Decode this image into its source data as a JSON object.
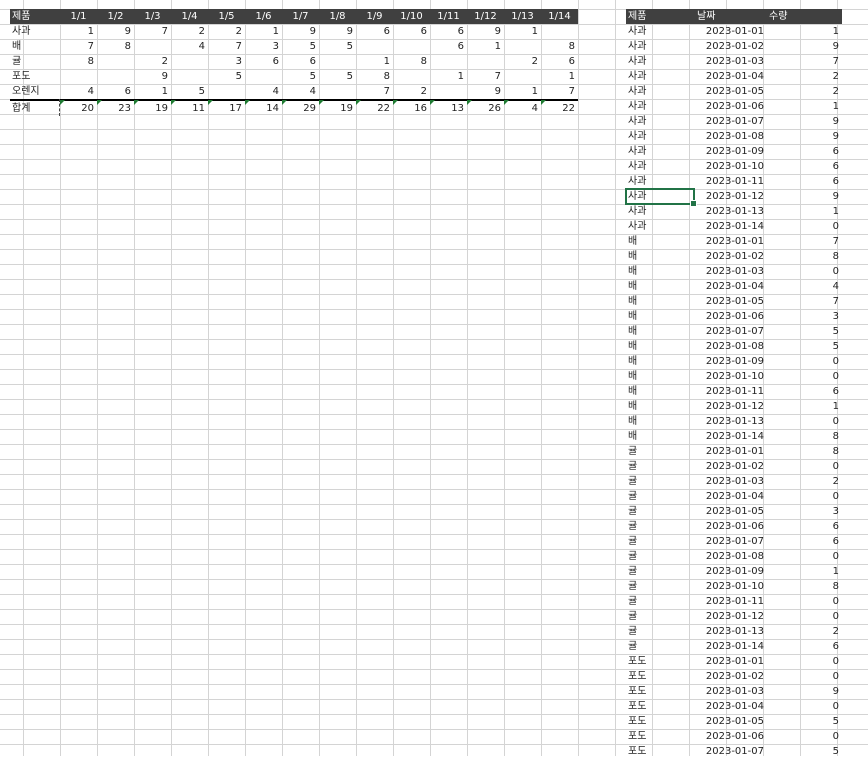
{
  "pivot": {
    "header_product": "제품",
    "dates": [
      "1/1",
      "1/2",
      "1/3",
      "1/4",
      "1/5",
      "1/6",
      "1/7",
      "1/8",
      "1/9",
      "1/10",
      "1/11",
      "1/12",
      "1/13",
      "1/14"
    ],
    "rows": [
      {
        "product": "사과",
        "values": [
          "1",
          "9",
          "7",
          "2",
          "2",
          "1",
          "9",
          "9",
          "6",
          "6",
          "6",
          "9",
          "1",
          ""
        ]
      },
      {
        "product": "배",
        "values": [
          "7",
          "8",
          "",
          "4",
          "7",
          "3",
          "5",
          "5",
          "",
          "",
          "6",
          "1",
          "",
          "8"
        ]
      },
      {
        "product": "귤",
        "values": [
          "8",
          "",
          "2",
          "",
          "3",
          "6",
          "6",
          "",
          "1",
          "8",
          "",
          "",
          "2",
          "6"
        ]
      },
      {
        "product": "포도",
        "values": [
          "",
          "",
          "9",
          "",
          "5",
          "",
          "5",
          "5",
          "8",
          "",
          "1",
          "7",
          "",
          "1"
        ]
      },
      {
        "product": "오렌지",
        "values": [
          "4",
          "6",
          "1",
          "5",
          "",
          "4",
          "4",
          "",
          "7",
          "2",
          "",
          "9",
          "1",
          "7"
        ]
      }
    ],
    "total": {
      "label": "합계",
      "values": [
        "20",
        "23",
        "19",
        "11",
        "17",
        "14",
        "29",
        "19",
        "22",
        "16",
        "13",
        "26",
        "4",
        "22"
      ]
    }
  },
  "source": {
    "headers": [
      "제품",
      "날짜",
      "수량"
    ],
    "rows": [
      [
        "사과",
        "2023-01-01",
        "1"
      ],
      [
        "사과",
        "2023-01-02",
        "9"
      ],
      [
        "사과",
        "2023-01-03",
        "7"
      ],
      [
        "사과",
        "2023-01-04",
        "2"
      ],
      [
        "사과",
        "2023-01-05",
        "2"
      ],
      [
        "사과",
        "2023-01-06",
        "1"
      ],
      [
        "사과",
        "2023-01-07",
        "9"
      ],
      [
        "사과",
        "2023-01-08",
        "9"
      ],
      [
        "사과",
        "2023-01-09",
        "6"
      ],
      [
        "사과",
        "2023-01-10",
        "6"
      ],
      [
        "사과",
        "2023-01-11",
        "6"
      ],
      [
        "사과",
        "2023-01-12",
        "9"
      ],
      [
        "사과",
        "2023-01-13",
        "1"
      ],
      [
        "사과",
        "2023-01-14",
        "0"
      ],
      [
        "배",
        "2023-01-01",
        "7"
      ],
      [
        "배",
        "2023-01-02",
        "8"
      ],
      [
        "배",
        "2023-01-03",
        "0"
      ],
      [
        "배",
        "2023-01-04",
        "4"
      ],
      [
        "배",
        "2023-01-05",
        "7"
      ],
      [
        "배",
        "2023-01-06",
        "3"
      ],
      [
        "배",
        "2023-01-07",
        "5"
      ],
      [
        "배",
        "2023-01-08",
        "5"
      ],
      [
        "배",
        "2023-01-09",
        "0"
      ],
      [
        "배",
        "2023-01-10",
        "0"
      ],
      [
        "배",
        "2023-01-11",
        "6"
      ],
      [
        "배",
        "2023-01-12",
        "1"
      ],
      [
        "배",
        "2023-01-13",
        "0"
      ],
      [
        "배",
        "2023-01-14",
        "8"
      ],
      [
        "귤",
        "2023-01-01",
        "8"
      ],
      [
        "귤",
        "2023-01-02",
        "0"
      ],
      [
        "귤",
        "2023-01-03",
        "2"
      ],
      [
        "귤",
        "2023-01-04",
        "0"
      ],
      [
        "귤",
        "2023-01-05",
        "3"
      ],
      [
        "귤",
        "2023-01-06",
        "6"
      ],
      [
        "귤",
        "2023-01-07",
        "6"
      ],
      [
        "귤",
        "2023-01-08",
        "0"
      ],
      [
        "귤",
        "2023-01-09",
        "1"
      ],
      [
        "귤",
        "2023-01-10",
        "8"
      ],
      [
        "귤",
        "2023-01-11",
        "0"
      ],
      [
        "귤",
        "2023-01-12",
        "0"
      ],
      [
        "귤",
        "2023-01-13",
        "2"
      ],
      [
        "귤",
        "2023-01-14",
        "6"
      ],
      [
        "포도",
        "2023-01-01",
        "0"
      ],
      [
        "포도",
        "2023-01-02",
        "0"
      ],
      [
        "포도",
        "2023-01-03",
        "9"
      ],
      [
        "포도",
        "2023-01-04",
        "0"
      ],
      [
        "포도",
        "2023-01-05",
        "5"
      ],
      [
        "포도",
        "2023-01-06",
        "0"
      ],
      [
        "포도",
        "2023-01-07",
        "5"
      ]
    ],
    "selected_row": 11
  },
  "colors": {
    "header_bg": "#404040",
    "header_text": "#ffffff",
    "gridline": "#d4d4d4",
    "selection": "#217346",
    "error_marker": "#1f7a32"
  }
}
